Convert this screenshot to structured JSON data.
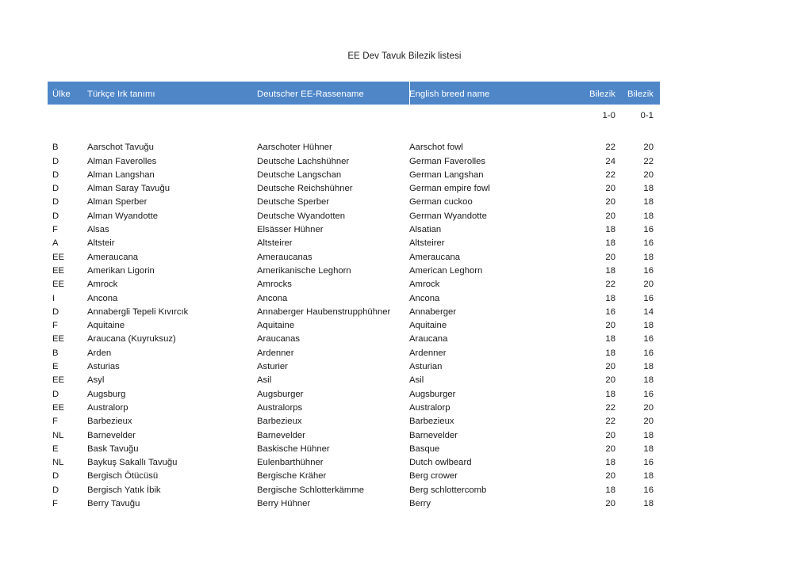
{
  "document": {
    "title": "EE Dev Tavuk Bilezik listesi"
  },
  "theme": {
    "header_background": "#4E86C8",
    "header_text": "#FFFFFF",
    "page_background": "#FFFFFF",
    "body_text": "#1A1A1A"
  },
  "table": {
    "headers": {
      "country": "Ülke",
      "turkish_name": "Türkçe Irk tanımı",
      "german_name": "Deutscher EE-Rassename",
      "english_name": "English breed name",
      "ring_1": "Bilezik",
      "ring_2": "Bilezik"
    },
    "subheaders": {
      "country": "",
      "turkish_name": "",
      "german_name": "",
      "english_name": "",
      "ring_1": "1-0",
      "ring_2": "0-1"
    },
    "rows": [
      {
        "country": "B",
        "turkish_name": "Aarschot Tavuğu",
        "german_name": "Aarschoter Hühner",
        "english_name": "Aarschot fowl",
        "ring_1": "22",
        "ring_2": "20"
      },
      {
        "country": "D",
        "turkish_name": "Alman Faverolles",
        "german_name": "Deutsche Lachshühner",
        "english_name": "German Faverolles",
        "ring_1": "24",
        "ring_2": "22"
      },
      {
        "country": "D",
        "turkish_name": "Alman Langshan",
        "german_name": "Deutsche Langschan",
        "english_name": "German Langshan",
        "ring_1": "22",
        "ring_2": "20"
      },
      {
        "country": "D",
        "turkish_name": "Alman Saray Tavuğu",
        "german_name": "Deutsche Reichshühner",
        "english_name": "German empire fowl",
        "ring_1": "20",
        "ring_2": "18"
      },
      {
        "country": "D",
        "turkish_name": "Alman Sperber",
        "german_name": "Deutsche Sperber",
        "english_name": "German cuckoo",
        "ring_1": "20",
        "ring_2": "18"
      },
      {
        "country": "D",
        "turkish_name": "Alman Wyandotte",
        "german_name": "Deutsche Wyandotten",
        "english_name": "German Wyandotte",
        "ring_1": "20",
        "ring_2": "18"
      },
      {
        "country": "F",
        "turkish_name": "Alsas",
        "german_name": "Elsässer Hühner",
        "english_name": "Alsatian",
        "ring_1": "18",
        "ring_2": "16"
      },
      {
        "country": "A",
        "turkish_name": "Altsteir",
        "german_name": "Altsteirer",
        "english_name": "Altsteirer",
        "ring_1": "18",
        "ring_2": "16"
      },
      {
        "country": "EE",
        "turkish_name": "Ameraucana",
        "german_name": "Ameraucanas",
        "english_name": "Ameraucana",
        "ring_1": "20",
        "ring_2": "18"
      },
      {
        "country": "EE",
        "turkish_name": "Amerikan Ligorin",
        "german_name": "Amerikanische Leghorn",
        "english_name": "American Leghorn",
        "ring_1": "18",
        "ring_2": "16"
      },
      {
        "country": "EE",
        "turkish_name": "Amrock",
        "german_name": "Amrocks",
        "english_name": "Amrock",
        "ring_1": "22",
        "ring_2": "20"
      },
      {
        "country": "I",
        "turkish_name": "Ancona",
        "german_name": "Ancona",
        "english_name": "Ancona",
        "ring_1": "18",
        "ring_2": "16"
      },
      {
        "country": "D",
        "turkish_name": "Annabergli Tepeli Kıvırcık",
        "german_name": "Annaberger Haubenstrupphühner",
        "english_name": "Annaberger",
        "ring_1": "16",
        "ring_2": "14"
      },
      {
        "country": "F",
        "turkish_name": "Aquitaine",
        "german_name": "Aquitaine",
        "english_name": "Aquitaine",
        "ring_1": "20",
        "ring_2": "18"
      },
      {
        "country": "EE",
        "turkish_name": "Araucana (Kuyruksuz)",
        "german_name": "Araucanas",
        "english_name": "Araucana",
        "ring_1": "18",
        "ring_2": "16"
      },
      {
        "country": "B",
        "turkish_name": "Arden",
        "german_name": "Ardenner",
        "english_name": "Ardenner",
        "ring_1": "18",
        "ring_2": "16"
      },
      {
        "country": "E",
        "turkish_name": "Asturias",
        "german_name": "Asturier",
        "english_name": "Asturian",
        "ring_1": "20",
        "ring_2": "18"
      },
      {
        "country": "EE",
        "turkish_name": "Asyl",
        "german_name": "Asil",
        "english_name": "Asil",
        "ring_1": "20",
        "ring_2": "18"
      },
      {
        "country": "D",
        "turkish_name": "Augsburg",
        "german_name": "Augsburger",
        "english_name": "Augsburger",
        "ring_1": "18",
        "ring_2": "16"
      },
      {
        "country": "EE",
        "turkish_name": "Australorp",
        "german_name": "Australorps",
        "english_name": "Australorp",
        "ring_1": "22",
        "ring_2": "20"
      },
      {
        "country": "F",
        "turkish_name": "Barbezieux",
        "german_name": "Barbezieux",
        "english_name": "Barbezieux",
        "ring_1": "22",
        "ring_2": "20"
      },
      {
        "country": "NL",
        "turkish_name": "Barnevelder",
        "german_name": "Barnevelder",
        "english_name": "Barnevelder",
        "ring_1": "20",
        "ring_2": "18"
      },
      {
        "country": "E",
        "turkish_name": "Bask Tavuğu",
        "german_name": "Baskische Hühner",
        "english_name": "Basque",
        "ring_1": "20",
        "ring_2": "18"
      },
      {
        "country": "NL",
        "turkish_name": "Baykuş Sakallı Tavuğu",
        "german_name": "Eulenbarthühner",
        "english_name": "Dutch owlbeard",
        "ring_1": "18",
        "ring_2": "16"
      },
      {
        "country": "D",
        "turkish_name": "Bergisch Ötücüsü",
        "german_name": "Bergische Kräher",
        "english_name": "Berg crower",
        "ring_1": "20",
        "ring_2": "18"
      },
      {
        "country": "D",
        "turkish_name": "Bergisch Yatık İbik",
        "german_name": "Bergische Schlotterkämme",
        "english_name": "Berg schlottercomb",
        "ring_1": "18",
        "ring_2": "16"
      },
      {
        "country": "F",
        "turkish_name": "Berry Tavuğu",
        "german_name": "Berry Hühner",
        "english_name": "Berry",
        "ring_1": "20",
        "ring_2": "18"
      }
    ]
  }
}
